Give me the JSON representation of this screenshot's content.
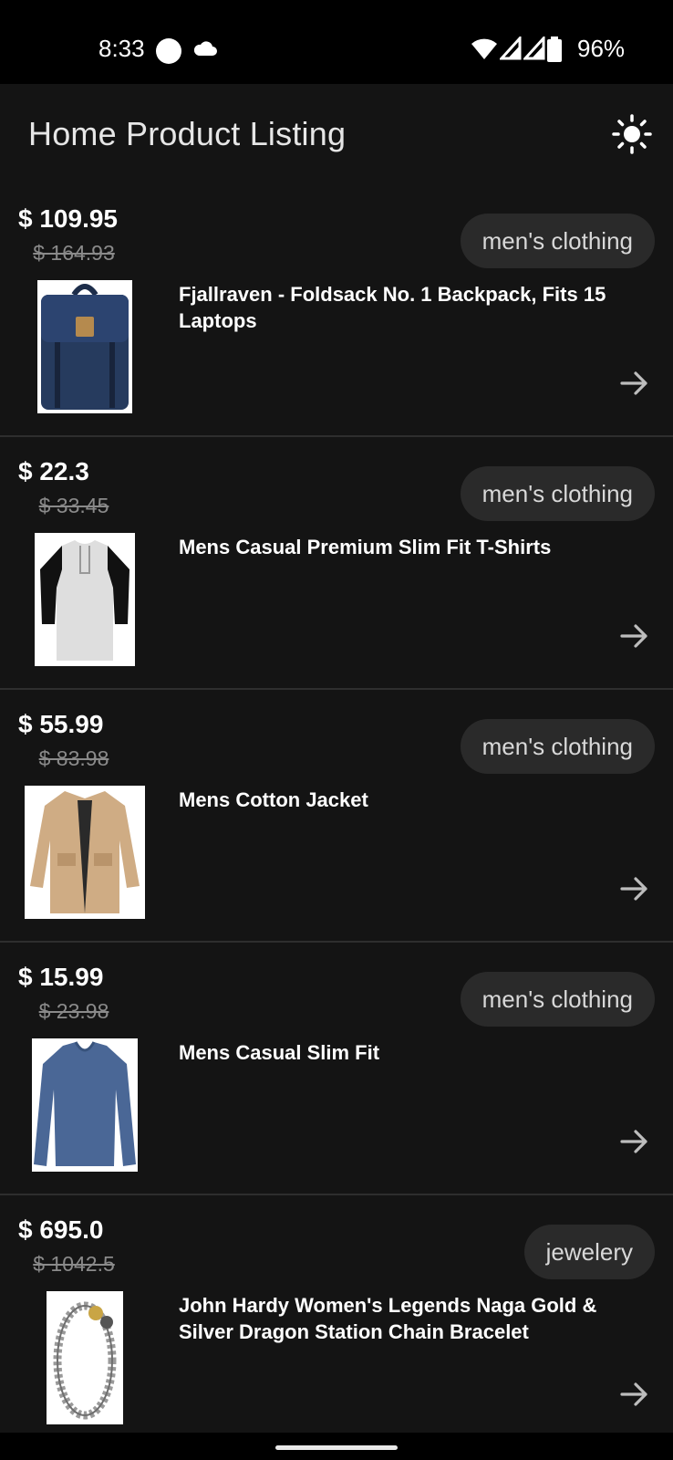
{
  "status_bar": {
    "time": "8:33",
    "battery": "96%",
    "icons": [
      "notification-dot-icon",
      "cloud-icon",
      "wifi-icon",
      "signal-icon",
      "signal-icon",
      "battery-icon"
    ]
  },
  "app_bar": {
    "title": "Home Product Listing",
    "theme_icon": "sun-icon"
  },
  "products": [
    {
      "price": "$ 109.95",
      "old_price": "$ 164.93",
      "category": "men's clothing",
      "title": "Fjallraven - Foldsack No. 1 Backpack, Fits 15 Laptops",
      "image": "backpack-image"
    },
    {
      "price": "$ 22.3",
      "old_price": "$ 33.45",
      "category": "men's clothing",
      "title": "Mens Casual Premium Slim Fit T-Shirts",
      "image": "tshirt-image"
    },
    {
      "price": "$ 55.99",
      "old_price": "$ 83.98",
      "category": "men's clothing",
      "title": "Mens Cotton Jacket",
      "image": "jacket-image"
    },
    {
      "price": "$ 15.99",
      "old_price": "$ 23.98",
      "category": "men's clothing",
      "title": "Mens Casual Slim Fit",
      "image": "longsleeve-image"
    },
    {
      "price": "$ 695.0",
      "old_price": "$ 1042.5",
      "category": "jewelery",
      "title": "John Hardy Women's Legends Naga Gold & Silver Dragon Station Chain Bracelet",
      "image": "bracelet-image"
    }
  ],
  "colors": {
    "background": "#141414",
    "chip": "#2a2a2a",
    "divider": "#2e2e2e",
    "strikethrough": "#8a8a8a"
  }
}
